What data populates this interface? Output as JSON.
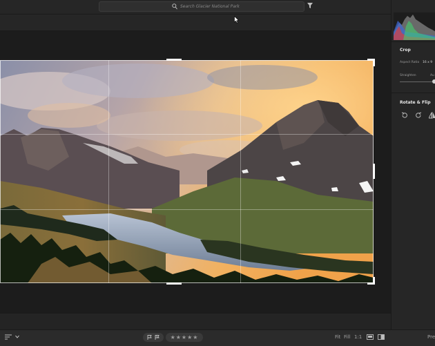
{
  "search": {
    "placeholder": "Search Glacier National Park"
  },
  "bottom": {
    "stars": "★★★★★",
    "fit": "Fit",
    "fill": "Fill",
    "ratio": "1:1",
    "presets_partial": "Pres"
  },
  "panel": {
    "crop_title": "Crop",
    "aspect_label": "Aspect Ratio",
    "aspect_value": "16 x 9",
    "straighten_label": "Straighten",
    "auto_partial": "Au",
    "rotate_title": "Rotate & Flip"
  },
  "icons": [
    "search-icon",
    "filter-icon",
    "cursor-icon",
    "sort-icon",
    "chevron-down-icon",
    "flag-icon",
    "reject-flag-icon",
    "grid-view-icon",
    "compare-icon",
    "rotate-left-icon",
    "rotate-right-icon",
    "flip-horizontal-icon"
  ]
}
